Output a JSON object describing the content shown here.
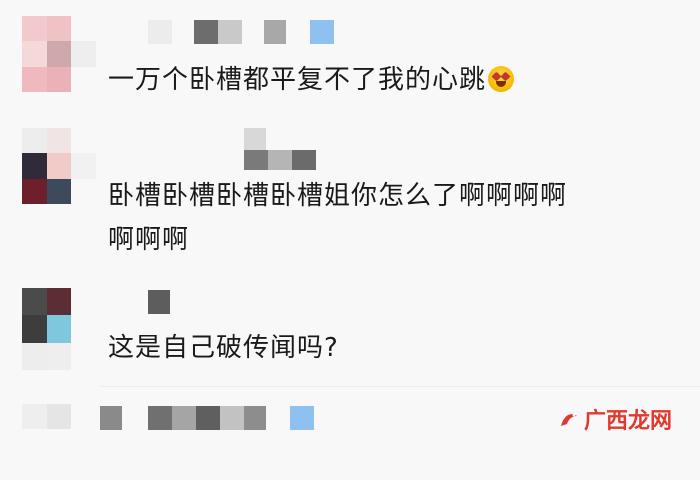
{
  "comments": [
    {
      "text": "一万个卧槽都平复不了我的心跳",
      "emoji": "star-struck-emoji"
    },
    {
      "text_line1": "卧槽卧槽卧槽卧槽姐你怎么了啊啊啊啊",
      "text_line2": "啊啊啊"
    },
    {
      "text": "这是自己破传闻吗?"
    }
  ],
  "watermark": {
    "text": "广西龙网"
  },
  "colors": {
    "text": "#1a1a1a",
    "background": "#f8f8f8",
    "watermark": "#e03a2e"
  }
}
